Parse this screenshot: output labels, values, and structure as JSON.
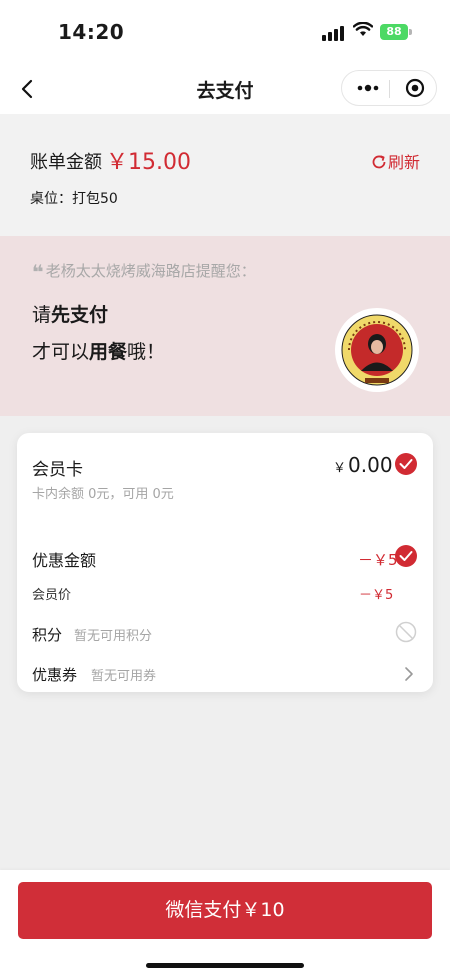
{
  "status": {
    "time": "14:20",
    "battery": "88"
  },
  "nav": {
    "title": "去支付"
  },
  "bill": {
    "label": "账单金额",
    "amount": "￥15.00",
    "refresh": "刷新",
    "table": "桌位：打包50"
  },
  "banner": {
    "quote": "老杨太太烧烤威海路店提醒您：",
    "line1": [
      "请",
      "先支付"
    ],
    "line2": [
      "才可以",
      "用餐",
      "哦！"
    ]
  },
  "card": {
    "member": {
      "title": "会员卡",
      "balance": "卡内余额 0元，可用 0元",
      "currency": "￥",
      "amount": "0.00"
    },
    "discount": {
      "title": "优惠金额",
      "amount": "－￥5"
    },
    "member_price": {
      "label": "会员价",
      "amount": "－￥5"
    },
    "points": {
      "label": "积分",
      "hint": "暂无可用积分"
    },
    "coupon": {
      "label": "优惠券",
      "hint": "暂无可用券"
    }
  },
  "pay": {
    "label": "微信支付￥10"
  },
  "colors": {
    "accent": "#d12b33",
    "pay_button": "#d02e38",
    "banner_bg": "#efe0e1"
  },
  "icons": [
    "back-arrow-icon",
    "more-dots-icon",
    "target-icon",
    "refresh-icon",
    "quote-icon",
    "check-icon",
    "disabled-icon",
    "chevron-right-icon"
  ]
}
